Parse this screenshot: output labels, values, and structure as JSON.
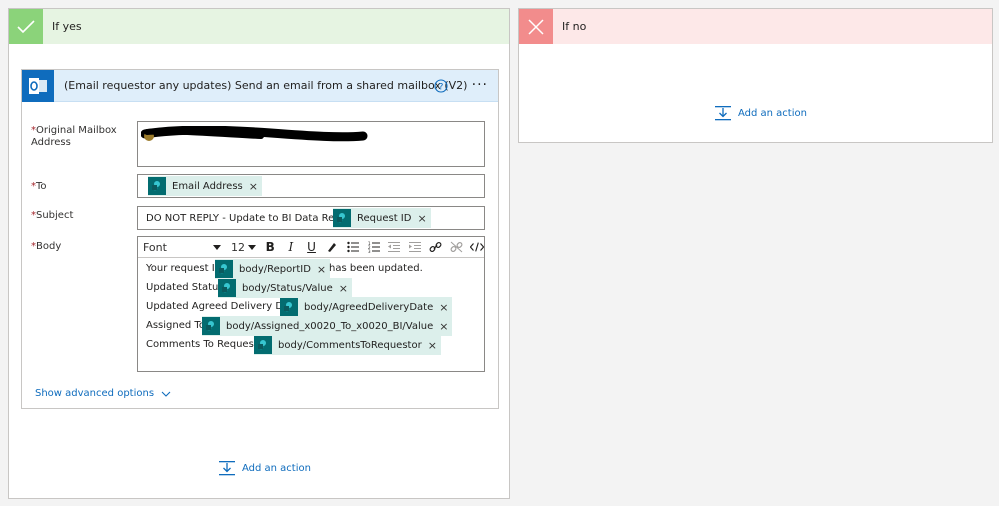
{
  "branches": {
    "yes": {
      "title": "If yes",
      "add_action": "Add an action"
    },
    "no": {
      "title": "If no",
      "add_action": "Add an action"
    }
  },
  "action_card": {
    "title": "(Email requestor any updates) Send an email from a shared mailbox (V2)",
    "icons": {
      "app": "outlook-icon",
      "help": "help-icon",
      "more": "more-options-icon"
    },
    "fields": {
      "mailbox": {
        "label": "Original Mailbox Address",
        "required_mark": "*"
      },
      "to": {
        "label": "To",
        "required_mark": "*",
        "tokens": [
          "Email Address"
        ]
      },
      "subject": {
        "label": "Subject",
        "required_mark": "*",
        "prefix_text": "DO NOT REPLY - Update to BI Data Request",
        "tokens": [
          "Request ID"
        ]
      },
      "body": {
        "label": "Body",
        "required_mark": "*",
        "toolbar": {
          "font": "Font",
          "size": "12"
        },
        "lines": [
          {
            "text": "Your request ID",
            "token": "body/ReportID",
            "suffix": "has been updated."
          },
          {
            "text": "Updated Status:",
            "token": "body/Status/Value",
            "suffix": ""
          },
          {
            "text": "Updated Agreed Delivery Date:",
            "token": "body/AgreedDeliveryDate",
            "suffix": ""
          },
          {
            "text": "Assigned To:",
            "token": "body/Assigned_x0020_To_x0020_BI/Value",
            "suffix": ""
          },
          {
            "text": "Comments To Requestor:",
            "token": "body/CommentsToRequestor",
            "suffix": ""
          }
        ]
      }
    },
    "advanced_link": "Show advanced options",
    "token_remove_glyph": "×"
  },
  "colors": {
    "yes_accent": "#8bd37a",
    "no_accent": "#f28c8c",
    "outlook_blue": "#0f6cbd",
    "sharepoint_teal": "#036c70",
    "link_blue": "#0f6cbd"
  }
}
